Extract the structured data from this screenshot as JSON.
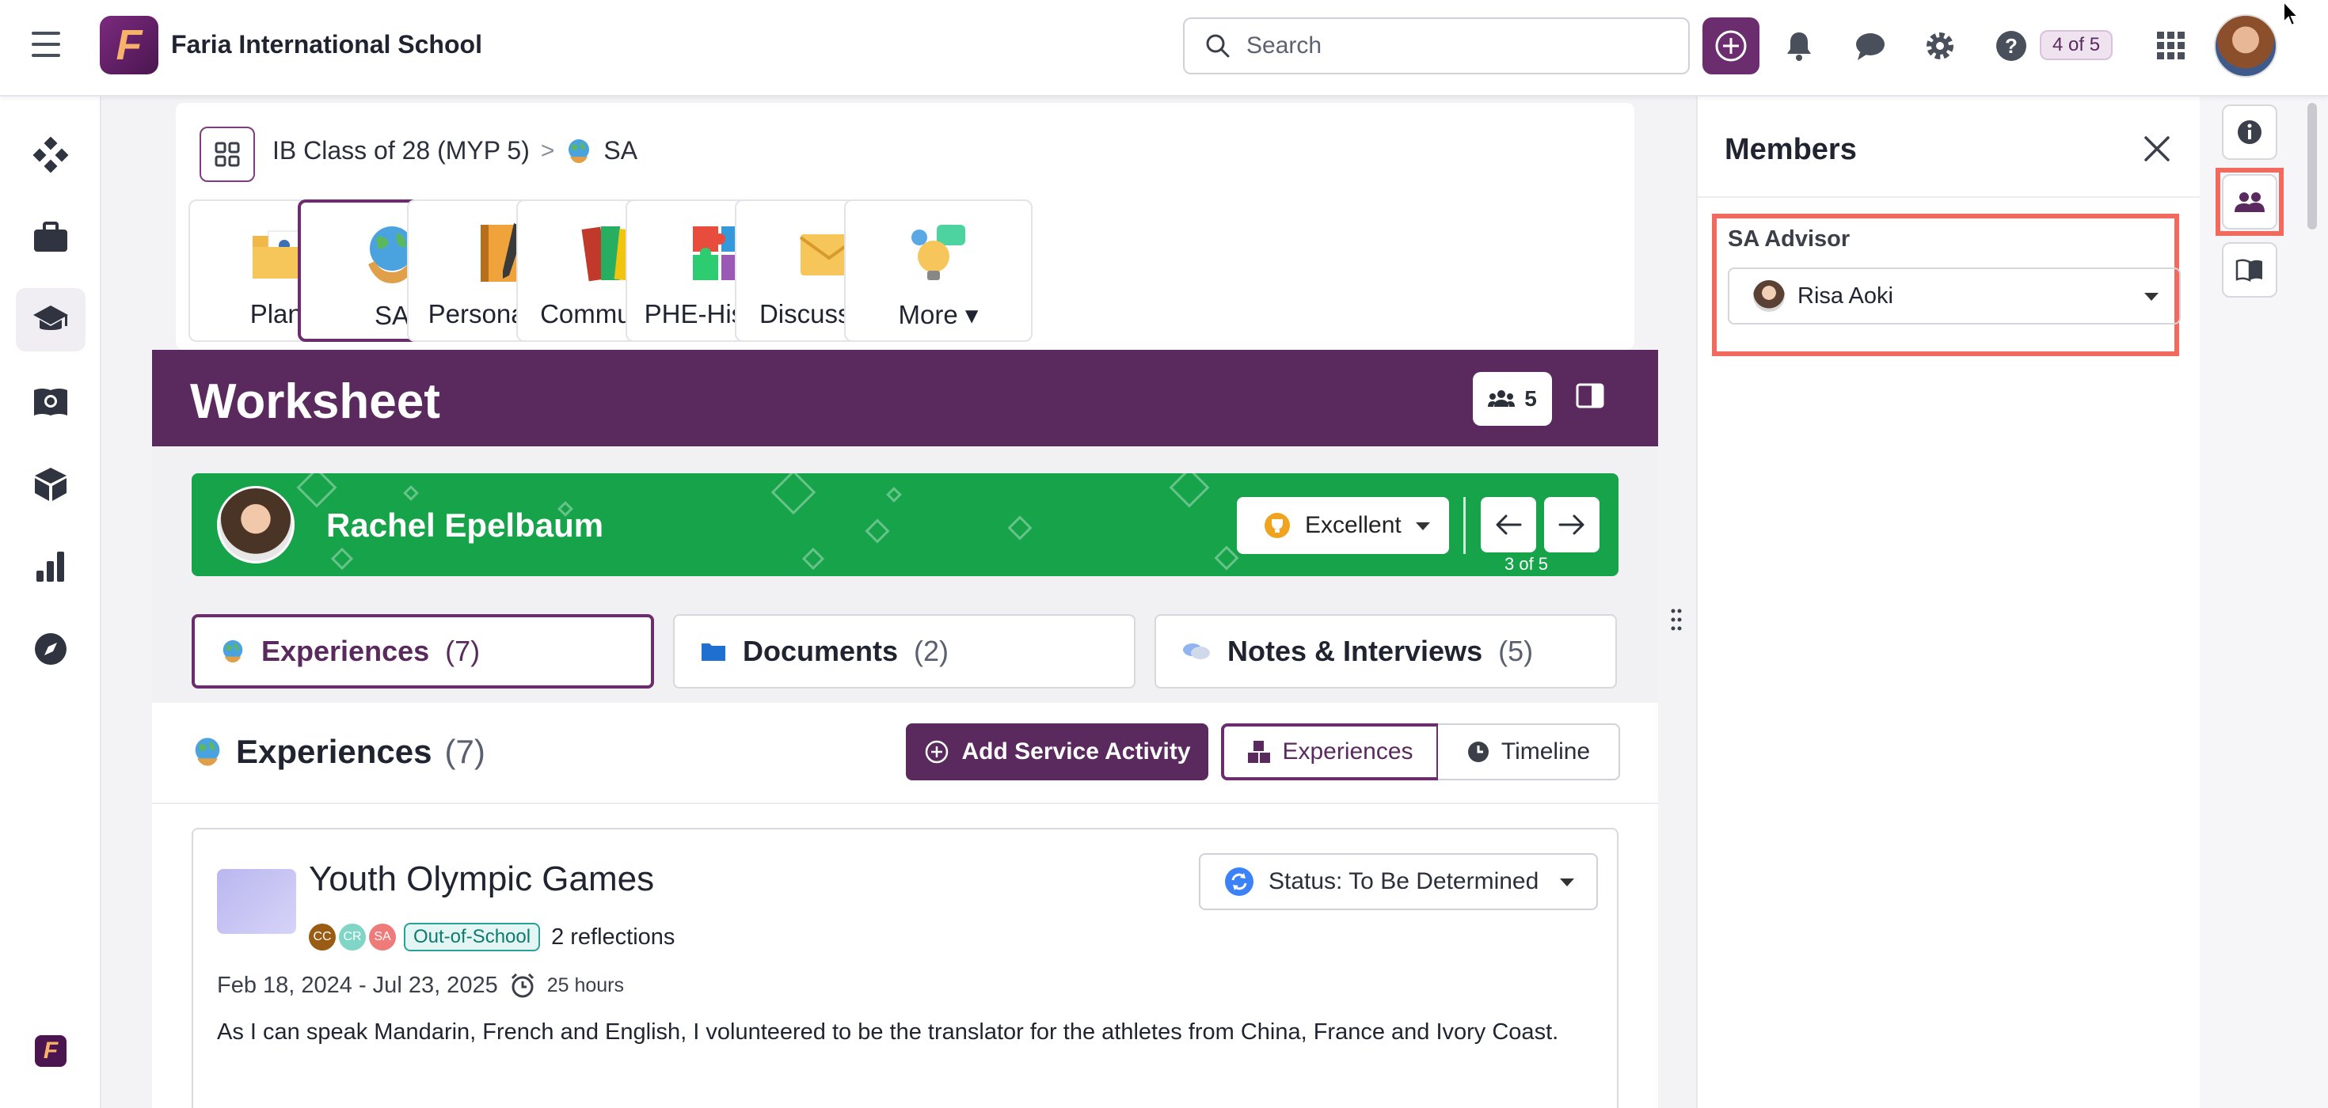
{
  "header": {
    "logo_letter": "F",
    "school_name": "Faria International School",
    "search_placeholder": "Search",
    "counter": "4 of 5",
    "icons": [
      "menu-icon",
      "plus-circle-icon",
      "bell-icon",
      "chat-icon",
      "gear-icon",
      "help-icon",
      "apps-grid-icon"
    ]
  },
  "leftnav": {
    "icons": [
      "dashboard-icon",
      "briefcase-icon",
      "graduation-cap-icon",
      "book-globe-icon",
      "cube-icon",
      "bar-chart-icon",
      "compass-icon"
    ],
    "active_index": 2
  },
  "breadcrumb": {
    "parent": "IB Class of 28 (MYP 5)",
    "separator": ">",
    "current": "SA"
  },
  "tiles": [
    {
      "label": "Plans",
      "icon": "folder-icon"
    },
    {
      "label": "SA",
      "icon": "globe-icon"
    },
    {
      "label": "Personal P...",
      "icon": "notebook-icon"
    },
    {
      "label": "Communit...",
      "icon": "books-icon"
    },
    {
      "label": "PHE-Histor...",
      "icon": "puzzle-icon"
    },
    {
      "label": "Discussions",
      "icon": "envelope-icon"
    },
    {
      "label": "More",
      "icon": "lightbulb-chat-icon"
    }
  ],
  "worksheet": {
    "title": "Worksheet",
    "members_count": "5"
  },
  "student": {
    "name": "Rachel Epelbaum",
    "grade": "Excellent",
    "position": "3 of 5"
  },
  "subtabs": [
    {
      "label": "Experiences",
      "count": "(7)"
    },
    {
      "label": "Documents",
      "count": "(2)"
    },
    {
      "label": "Notes & Interviews",
      "count": "(5)"
    }
  ],
  "experiences": {
    "heading": "Experiences",
    "count": "(7)",
    "add_button": "Add Service Activity",
    "view_experiences": "Experiences",
    "view_timeline": "Timeline"
  },
  "experience_card": {
    "title": "Youth Olympic Games",
    "badges": [
      {
        "text": "CC",
        "color": "#9a5b13"
      },
      {
        "text": "CR",
        "color": "#7fd6c6"
      },
      {
        "text": "SA",
        "color": "#ef7a7a"
      }
    ],
    "tag": "Out-of-School",
    "reflections": "2 reflections",
    "status": "Status: To Be Determined",
    "dates": "Feb 18, 2024 - Jul 23, 2025",
    "hours": "25 hours",
    "description": "As I can speak Mandarin, French and English, I volunteered to be the translator for the athletes from China, France and Ivory Coast."
  },
  "members_panel": {
    "title": "Members",
    "role_label": "SA Advisor",
    "advisor_name": "Risa Aoki"
  },
  "colors": {
    "brand_purple": "#5a2a5e",
    "banner_green": "#16a34a",
    "highlight_red": "#f26a5e"
  }
}
